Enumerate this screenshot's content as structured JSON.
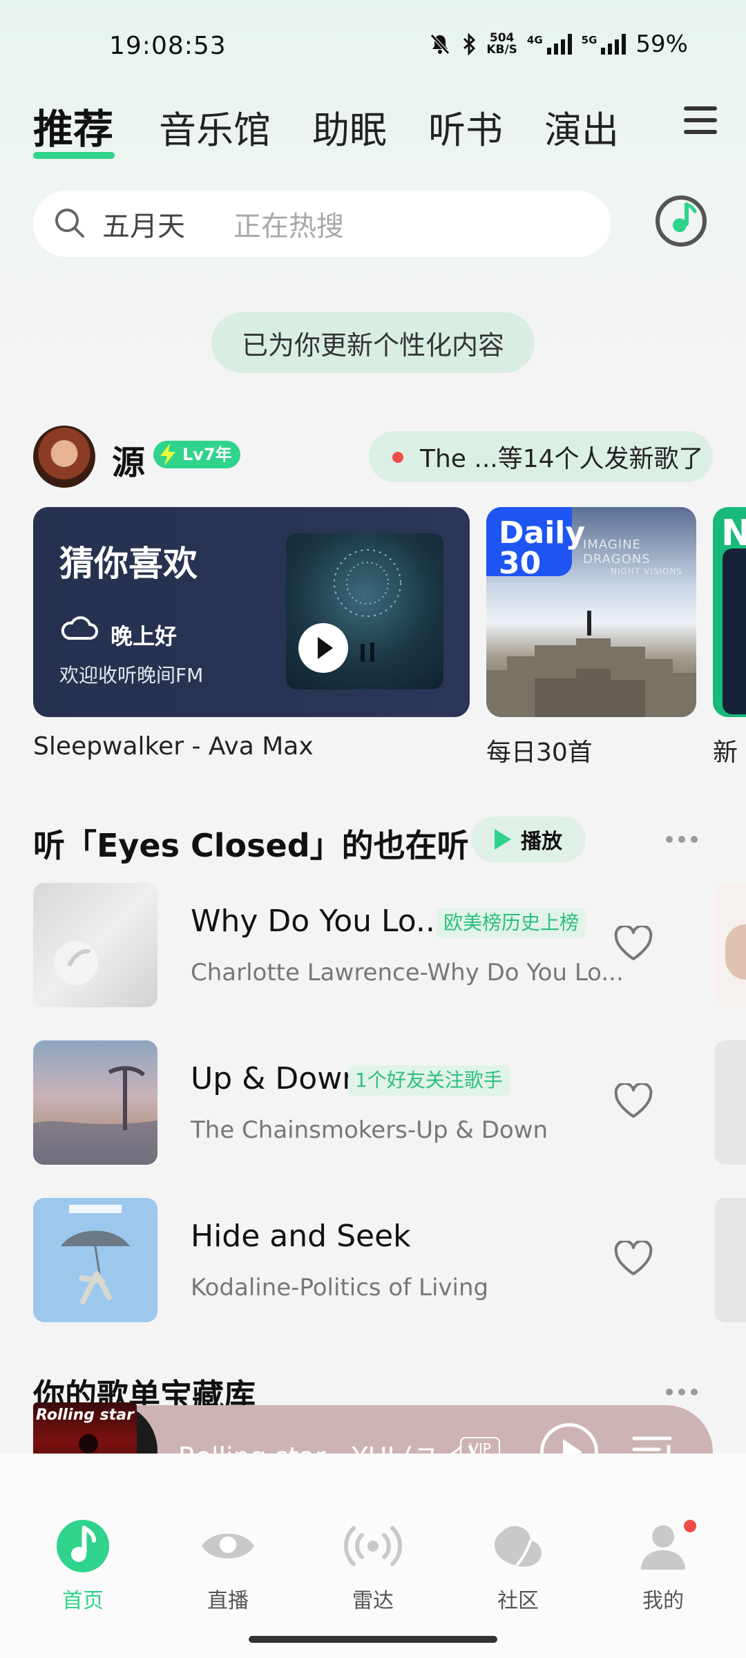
{
  "status_bar": {
    "time": "19:08:53",
    "net_speed_value": "504",
    "net_speed_unit": "KB/S",
    "sim1_type": "4G",
    "sim2_type": "5G",
    "battery": "59%"
  },
  "tabs": [
    {
      "label": "推荐",
      "active": true
    },
    {
      "label": "音乐馆",
      "active": false
    },
    {
      "label": "助眠",
      "active": false
    },
    {
      "label": "听书",
      "active": false
    },
    {
      "label": "演出",
      "active": false
    }
  ],
  "search": {
    "keyword": "五月天",
    "hint": "正在热搜"
  },
  "notice": "已为你更新个性化内容",
  "user": {
    "name": "源",
    "level_badge": "Lv7年",
    "friends_update": "The ...等14个人发新歌了"
  },
  "cards": {
    "guess": {
      "title": "猜你喜欢",
      "greeting": "晚上好",
      "subtitle": "欢迎收听晚间FM",
      "caption": "Sleepwalker - Ava Max"
    },
    "daily": {
      "badge_line1": "Daily",
      "badge_line2": "30",
      "art_text": "IMAGINE DRAGONS",
      "art_subtext": "NIGHT VISIONS",
      "caption": "每日30首"
    },
    "next": {
      "badge_letter": "N",
      "caption": "新"
    }
  },
  "section_similar": {
    "title": "听「Eyes Closed」的也在听",
    "play_label": "播放",
    "songs": [
      {
        "title": "Why Do You Lo...",
        "tag": "欧美榜历史上榜",
        "artist": "Charlotte Lawrence-Why Do You Lo..."
      },
      {
        "title": "Up & Down",
        "tag": "1个好友关注歌手",
        "artist": "The Chainsmokers-Up & Down"
      },
      {
        "title": "Hide and Seek",
        "tag": "",
        "artist": "Kodaline-Politics of Living"
      }
    ]
  },
  "section_treasure": {
    "title": "你的歌单宝藏库"
  },
  "mini_player": {
    "song": "Rolling star - YUI (ユイ)",
    "vip": "VIP",
    "cover_text": "Rolling star YUI",
    "bg_color": "#cdb3b3"
  },
  "bottom_nav": [
    {
      "label": "首页",
      "icon": "music-note-icon",
      "active": true
    },
    {
      "label": "直播",
      "icon": "eye-icon",
      "active": false
    },
    {
      "label": "雷达",
      "icon": "radar-icon",
      "active": false
    },
    {
      "label": "社区",
      "icon": "community-icon",
      "active": false
    },
    {
      "label": "我的",
      "icon": "profile-icon",
      "active": false
    }
  ],
  "colors": {
    "accent": "#2fd38b",
    "notification_dot": "#f04a4a"
  }
}
